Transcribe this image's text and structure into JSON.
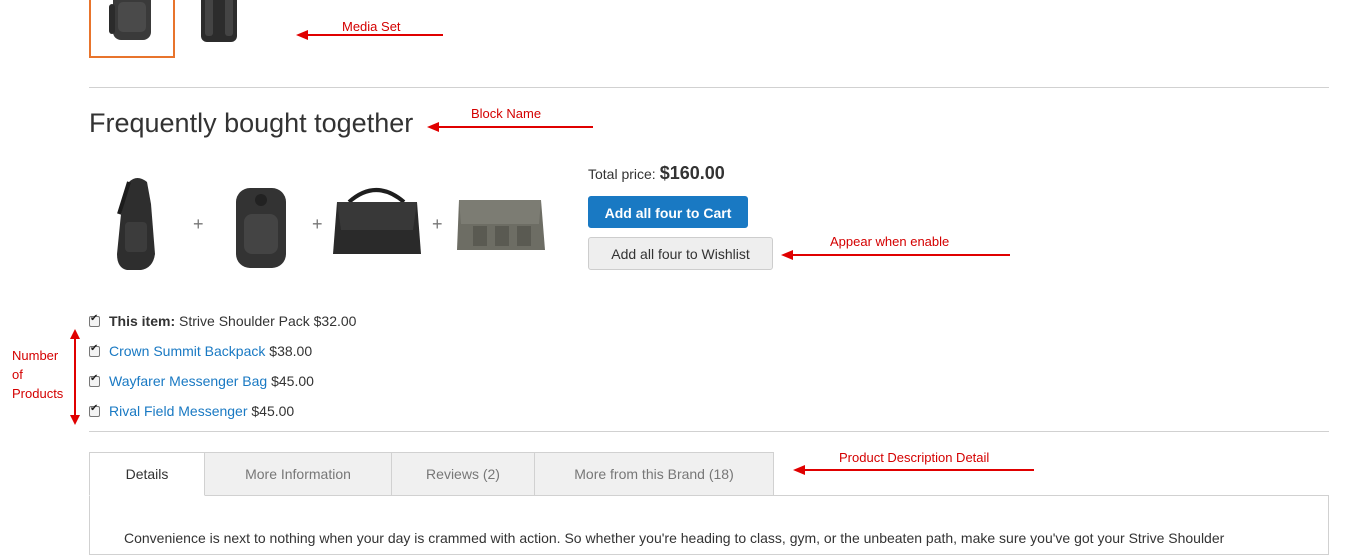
{
  "block": {
    "title": "Frequently bought together",
    "total_label": "Total price:",
    "total_value": "$160.00",
    "add_cart_label": "Add all four to Cart",
    "add_wishlist_label": "Add all four to Wishlist",
    "plus": "+"
  },
  "items": [
    {
      "prefix": "This item:",
      "name": "Strive Shoulder Pack",
      "price": "$32.00",
      "checked": true
    },
    {
      "name": "Crown Summit Backpack",
      "price": "$38.00",
      "checked": true
    },
    {
      "name": "Wayfarer Messenger Bag",
      "price": "$45.00",
      "checked": true
    },
    {
      "name": "Rival Field Messenger",
      "price": "$45.00",
      "checked": true
    }
  ],
  "tabs": [
    {
      "label": "Details",
      "active": true
    },
    {
      "label": "More Information"
    },
    {
      "label": "Reviews (2)"
    },
    {
      "label": "More from this Brand (18)"
    }
  ],
  "description": "Convenience is next to nothing when your day is crammed with action. So whether you're heading to class, gym, or the unbeaten path, make sure you've got your Strive Shoulder",
  "annotations": {
    "media_set": "Media Set",
    "block_name": "Block Name",
    "appear_when_enable": "Appear when enable",
    "number_of_products_line1": "Number",
    "number_of_products_line2": "of",
    "number_of_products_line3": "Products",
    "product_description_detail": "Product Description Detail"
  },
  "colors": {
    "accent": "#1979c3",
    "annotation": "#d40000",
    "thumb_active_border": "#e8742c"
  },
  "icons": [
    "backpack-image",
    "sling-bag-image",
    "messenger-bag-image",
    "canvas-messenger-image",
    "checkbox-checked-icon",
    "arrow-left-icon"
  ]
}
